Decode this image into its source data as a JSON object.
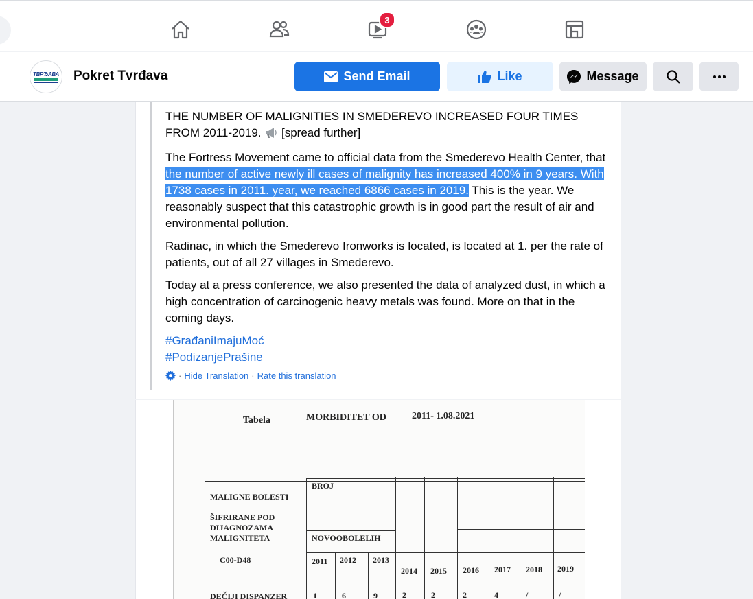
{
  "nav": {
    "watch_badge": "3",
    "icons": [
      "home-icon",
      "friends-icon",
      "watch-icon",
      "groups-icon",
      "gaming-icon"
    ]
  },
  "page": {
    "name": "Pokret Tvrđava",
    "avatar_text": "ТВРЂАВА"
  },
  "actions": {
    "send_email": "Send Email",
    "like": "Like",
    "message": "Message"
  },
  "post": {
    "title_line": "THE NUMBER OF MALIGNITIES IN SMEDEREVO INCREASED FOUR TIMES FROM 2011-2019.",
    "title_suffix": "[spread further]",
    "p1_start": "The Fortress Movement came to official data from the Smederevo Health Center, that",
    "p1_highlight": " the number of active newly ill cases of malignity has increased 400% in 9 years. With 1738 cases in 2011. year, we reached 6866 cases in 2019.",
    "p1_end": " This is the year. We reasonably suspect that this catastrophic growth is in good part the result of air and environmental pollution.",
    "p2": "Radinac, in which the Smederevo Ironworks is located, is located at 1. per the rate of patients, out of all 27 villages in Smederevo.",
    "p3": "Today at a press conference, we also presented the data of analyzed dust, in which a high concentration of carcinogenic heavy metals was found. More on that in the coming days.",
    "hashtag1": "#GrađaniImajuMoć",
    "hashtag2": "#PodizanjePrašine",
    "hide_translation": "Hide Translation",
    "rate_translation": "Rate this translation",
    "separator": "·"
  },
  "document": {
    "tabela": "Tabela",
    "heading": "MORBIDITET  OD",
    "period": "2011-  1.08.2021",
    "col_broj": "BROJ",
    "row_label_1": "MALIGNE  BOLESTI",
    "row_label_2": "ŠIFRIRANE POD",
    "row_label_3": "DIJAGNOZAMA",
    "row_label_4": "MALIGNITETA",
    "row_label_5": "C00-D48",
    "col_novo": "NOVOOBOLELIH",
    "years": [
      "2011",
      "2012",
      "2013",
      "2014",
      "2015",
      "2016",
      "2017",
      "2018",
      "2019"
    ],
    "row1_label": "DEČIJI DISPANZER",
    "row1_values": [
      "1",
      "6",
      "9",
      "2",
      "2",
      "2",
      "4",
      "/",
      "/"
    ]
  }
}
